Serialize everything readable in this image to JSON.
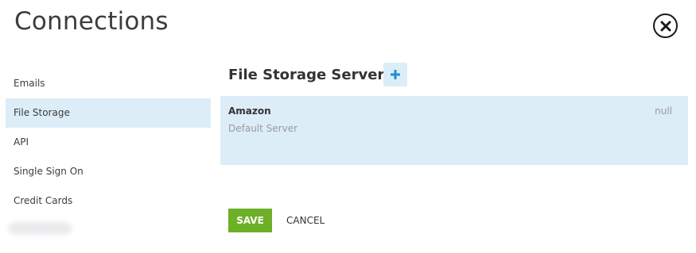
{
  "page": {
    "title": "Connections"
  },
  "icons": {
    "close": "close-circle-icon",
    "add": "plus-icon"
  },
  "colors": {
    "accent_bg": "#dcedf8",
    "plus": "#1e90d0",
    "save_bg": "#6eaf28",
    "muted_text": "#9a9a9a"
  },
  "sidebar": {
    "items": [
      {
        "label": "Emails",
        "active": false
      },
      {
        "label": "File Storage",
        "active": true
      },
      {
        "label": "API",
        "active": false
      },
      {
        "label": "Single Sign On",
        "active": false
      },
      {
        "label": "Credit Cards",
        "active": false
      }
    ]
  },
  "main": {
    "section_title": "File Storage Servers",
    "servers": [
      {
        "name": "Amazon",
        "subtitle": "Default Server",
        "status": "null"
      }
    ]
  },
  "actions": {
    "save_label": "SAVE",
    "cancel_label": "CANCEL"
  }
}
